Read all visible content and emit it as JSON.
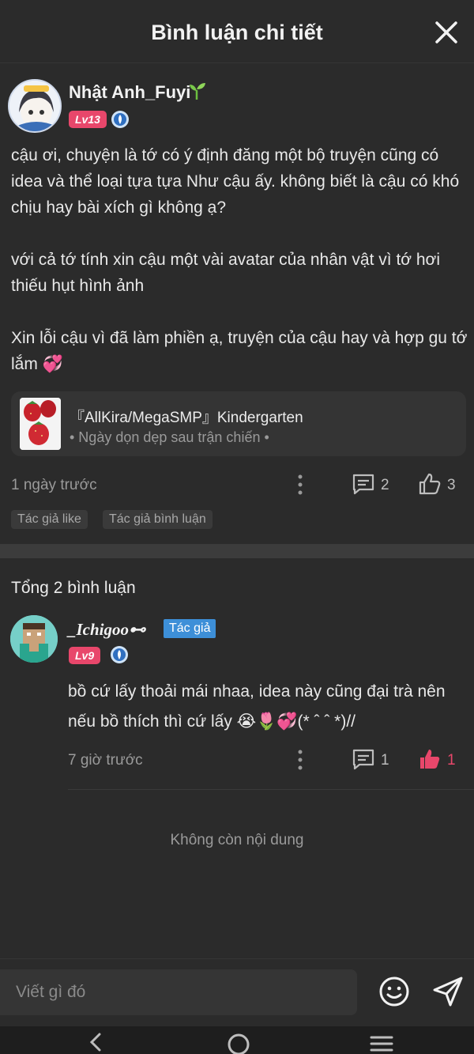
{
  "header": {
    "title": "Bình luận chi tiết"
  },
  "post": {
    "author": "Nhật Anh_Fuyi",
    "level": "Lv13",
    "paragraphs": [
      "cậu ơi, chuyện là tớ có ý định đăng một bộ truyện cũng có idea và thể loại tựa tựa Như cậu ấy. không biết là cậu có khó chịu hay bài xích gì không ạ?",
      "với cả tớ tính xin cậu một vài avatar của nhân vật vì tớ hơi thiếu hụt hình ảnh",
      "Xin lỗi cậu vì đã làm phiền ạ, truyện của cậu hay và hợp gu tớ lắm 💞"
    ],
    "ref": {
      "title": "『AllKira/MegaSMP』Kindergarten",
      "subtitle": "• Ngày dọn dẹp sau trận chiến •"
    },
    "time": "1 ngày trước",
    "comment_count": "2",
    "like_count": "3",
    "chips": [
      "Tác giả like",
      "Tác giả bình luận"
    ]
  },
  "comments": {
    "total_label": "Tổng 2 bình luận",
    "items": [
      {
        "author": "_Ichigoo⊷",
        "author_tag": "Tác giả",
        "level": "Lv9",
        "text_line1": "bồ cứ lấy thoải mái nhaa, idea này cũng đại trà nên",
        "text_line2": "nếu bồ thích thì cứ lấy 😭🌷💞(* ˆ ˆ *)//",
        "time": "7 giờ trước",
        "comment_count": "1",
        "like_count": "1"
      }
    ],
    "end_label": "Không còn nội dung"
  },
  "input": {
    "placeholder": "Viết gì đó"
  },
  "colors": {
    "level_badge": "#e8476b",
    "author_tag": "#3d8fd8",
    "liked": "#e8476b",
    "background": "#2b2b2b"
  }
}
